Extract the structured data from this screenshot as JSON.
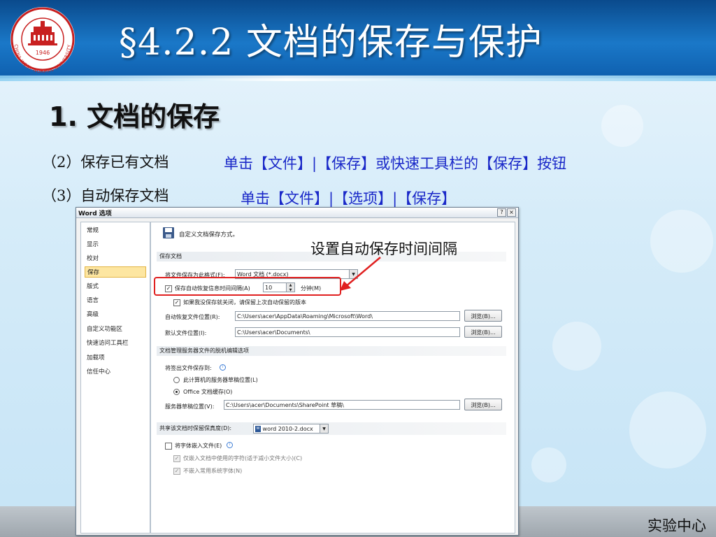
{
  "slide": {
    "title": "§4.2.2  文档的保存与保护",
    "heading_num": "1.",
    "heading_text": "文档的保存",
    "steps": [
      {
        "label": "（2）保存已有文档",
        "instruction": "单击【文件】|【保存】或快速工具栏的【保存】按钮"
      },
      {
        "label": "（3）自动保存文档",
        "instruction": "单击【文件】|【选项】|【保存】"
      }
    ],
    "callout": "设置自动保存时间间隔",
    "footer": "实验中心",
    "logo": {
      "year": "1946",
      "ring_text": "CHINA WEST NORMAL UNIVERSITY"
    }
  },
  "dialog": {
    "title": "Word 选项",
    "help_btn": "?",
    "close_btn": "×",
    "nav_items": [
      "常规",
      "显示",
      "校对",
      "保存",
      "版式",
      "语言",
      "高级",
      "自定义功能区",
      "快速访问工具栏",
      "加载项",
      "信任中心"
    ],
    "selected_nav": "保存",
    "header_text": "自定义文档保存方式。",
    "save_group": {
      "title": "保存文档",
      "format_label": "将文件保存为此格式(F):",
      "format_value": "Word 文档 (*.docx)",
      "autorecover_label": "保存自动恢复信息时间间隔(A)",
      "autorecover_minutes": "10",
      "minutes_label": "分钟(M)",
      "keep_last_label": "如果我没保存就关闭，请保留上次自动保留的版本",
      "autorecover_location_label": "自动恢复文件位置(R):",
      "autorecover_location_value": "C:\\Users\\acer\\AppData\\Roaming\\Microsoft\\Word\\",
      "default_location_label": "默认文件位置(I):",
      "default_location_value": "C:\\Users\\acer\\Documents\\",
      "browse_label": "浏览(B)..."
    },
    "offline_group": {
      "title": "文档管理服务器文件的脱机编辑选项",
      "save_checked_out_label": "将签出文件保存到:",
      "option_server": "此计算机的服务器草稿位置(L)",
      "option_office_cache": "Office 文档缓存(O)",
      "server_drafts_label": "服务器草稿位置(V):",
      "server_drafts_value": "C:\\Users\\acer\\Documents\\SharePoint 草稿\\",
      "browse_label": "浏览(B)..."
    },
    "fidelity_group": {
      "title": "共享该文档时保留保真度(D):",
      "document_value": "word 2010-2.docx",
      "embed_fonts_label": "将字体嵌入文件(E)",
      "embed_used_chars_label": "仅嵌入文档中使用的字符(适于减小文件大小)(C)",
      "no_common_fonts_label": "不嵌入常用系统字体(N)"
    }
  },
  "colors": {
    "header_blue": "#1a78c8",
    "instruction_blue": "#1a28c8",
    "highlight_red": "#e02020",
    "nav_selected": "#fde6a1"
  }
}
